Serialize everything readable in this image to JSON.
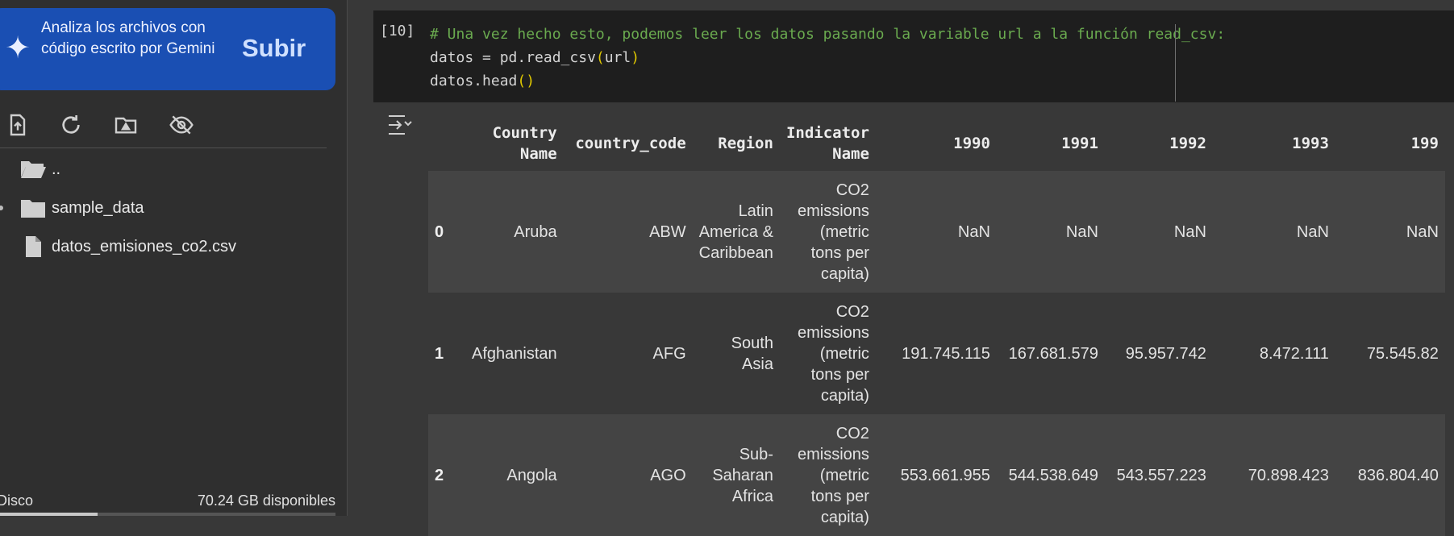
{
  "sidebar": {
    "gemini_banner": {
      "text": "Analiza los archivos con código escrito por Gemini",
      "button_label": "Subir"
    },
    "toolbar_icons": [
      "upload-file-icon",
      "refresh-icon",
      "mount-drive-icon",
      "hide-files-icon"
    ],
    "files": [
      {
        "name": "..",
        "icon": "folder-open-icon"
      },
      {
        "name": "sample_data",
        "icon": "folder-icon"
      },
      {
        "name": "datos_emisiones_co2.csv",
        "icon": "file-icon"
      }
    ],
    "disk": {
      "label": "Disco",
      "free": "70.24 GB disponibles",
      "used_fraction": 0.29
    }
  },
  "cell": {
    "execution_count": "[10]",
    "code": {
      "line1": "# Una vez hecho esto, podemos leer los datos pasando la variable url a la función read_csv:",
      "line2_prefix": "datos = pd.read_csv",
      "line2_open": "(",
      "line2_arg": "url",
      "line2_close": ")",
      "line3_prefix": "datos.head",
      "line3_parens": "()"
    }
  },
  "output": {
    "table": {
      "headers": [
        "",
        "Country Name",
        "country_code",
        "Region",
        "Indicator Name",
        "1990",
        "1991",
        "1992",
        "1993",
        "199"
      ],
      "rows": [
        [
          "0",
          "Aruba",
          "ABW",
          "Latin America & Caribbean",
          "CO2 emissions (metric tons per capita)",
          "NaN",
          "NaN",
          "NaN",
          "NaN",
          "NaN"
        ],
        [
          "1",
          "Afghanistan",
          "AFG",
          "South Asia",
          "CO2 emissions (metric tons per capita)",
          "191.745.115",
          "167.681.579",
          "95.957.742",
          "8.472.111",
          "75.545.82"
        ],
        [
          "2",
          "Angola",
          "AGO",
          "Sub-Saharan Africa",
          "CO2 emissions (metric tons per capita)",
          "553.661.955",
          "544.538.649",
          "543.557.223",
          "70.898.423",
          "836.804.40"
        ]
      ]
    }
  }
}
